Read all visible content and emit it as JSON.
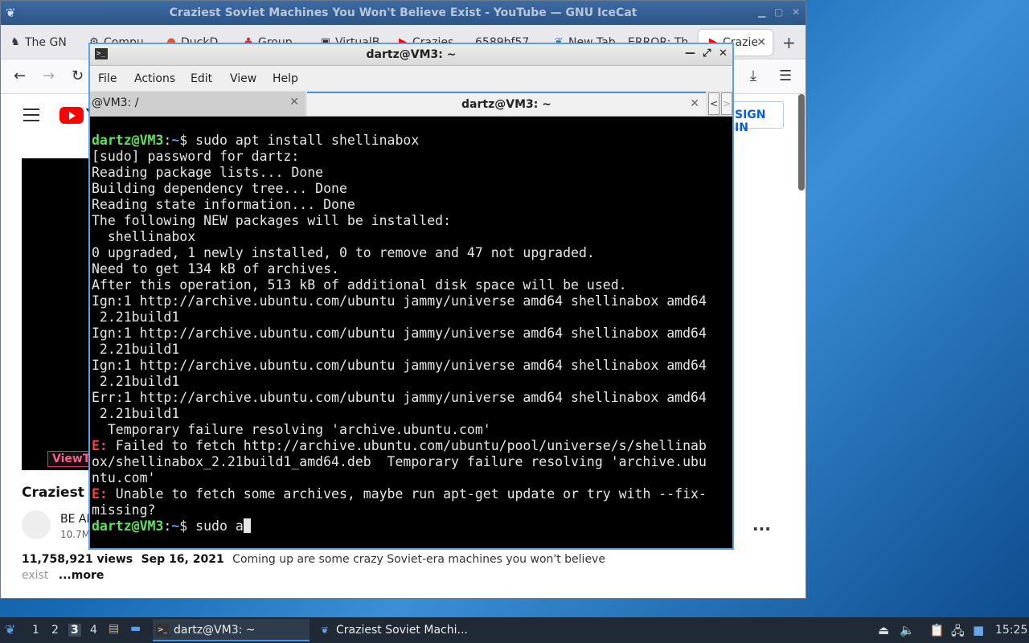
{
  "browser": {
    "window_title": "Craziest Soviet Machines You Won't Believe Exist - YouTube — GNU IceCat",
    "tabs": [
      {
        "label": "The GN",
        "favicon": "gnu-icon"
      },
      {
        "label": "Compu",
        "favicon": "puzzle-icon"
      },
      {
        "label": "DuckD",
        "favicon": "duck-icon"
      },
      {
        "label": "Group",
        "favicon": "group-icon"
      },
      {
        "label": "VirtualB",
        "favicon": "virtualbox-icon"
      },
      {
        "label": "Crazies",
        "favicon": "youtube-icon"
      },
      {
        "label": "6589bf57",
        "favicon": ""
      },
      {
        "label": "New Tab",
        "favicon": "icecat-icon"
      },
      {
        "label": "ERROR: Th",
        "favicon": ""
      },
      {
        "label": "Crazie",
        "favicon": "youtube-icon",
        "active": true
      }
    ],
    "newtab": "+",
    "youtube": {
      "logo_text": "Y",
      "sign_in": "SIGN IN",
      "video_badge": "ViewT",
      "video_title": "Craziest So",
      "channel_name": "BE AM",
      "channel_subs": "10.7M",
      "more_actions": "...",
      "views": "11,758,921 views",
      "date": "Sep 16, 2021",
      "description": "Coming up are some crazy Soviet-era machines you won't believe",
      "description_line2": "exist",
      "more_link": "...more"
    }
  },
  "terminal": {
    "window_title": "dartz@VM3: ~",
    "menu": [
      "File",
      "Actions",
      "Edit",
      "View",
      "Help"
    ],
    "tabs": [
      {
        "label": "@VM3: /",
        "active": false
      },
      {
        "label": "dartz@VM3: ~",
        "active": true
      }
    ],
    "close_glyph": "✕",
    "prompt_user": "dartz@VM3",
    "prompt_path": "~",
    "lines": {
      "l1_cmd": "$ sudo apt install shellinabox",
      "l2": "[sudo] password for dartz:",
      "l3": "Reading package lists... Done",
      "l4": "Building dependency tree... Done",
      "l5": "Reading state information... Done",
      "l6": "The following NEW packages will be installed:",
      "l7": "  shellinabox",
      "l8": "0 upgraded, 1 newly installed, 0 to remove and 47 not upgraded.",
      "l9": "Need to get 134 kB of archives.",
      "l10": "After this operation, 513 kB of additional disk space will be used.",
      "l11": "Ign:1 http://archive.ubuntu.com/ubuntu jammy/universe amd64 shellinabox amd64",
      "l12": " 2.21build1",
      "l13": "Ign:1 http://archive.ubuntu.com/ubuntu jammy/universe amd64 shellinabox amd64",
      "l14": " 2.21build1",
      "l15": "Ign:1 http://archive.ubuntu.com/ubuntu jammy/universe amd64 shellinabox amd64",
      "l16": " 2.21build1",
      "l17": "Err:1 http://archive.ubuntu.com/ubuntu jammy/universe amd64 shellinabox amd64",
      "l18": " 2.21build1",
      "l19": "  Temporary failure resolving 'archive.ubuntu.com'",
      "err_tag": "E:",
      "l20": " Failed to fetch http://archive.ubuntu.com/ubuntu/pool/universe/s/shellinab",
      "l21": "ox/shellinabox_2.21build1_amd64.deb  Temporary failure resolving 'archive.ubu",
      "l22": "ntu.com'",
      "l23": " Unable to fetch some archives, maybe run apt-get update or try with --fix-",
      "l24": "missing?",
      "l25_cmd": "$ sudo a"
    }
  },
  "taskbar": {
    "workspaces": [
      "1",
      "2",
      "3",
      "4"
    ],
    "active_workspace": "3",
    "tasks": [
      {
        "label": "dartz@VM3: ~",
        "icon": "terminal-icon"
      },
      {
        "label": "Craziest Soviet Machi...",
        "icon": "icecat-icon"
      }
    ],
    "clock": "15:25"
  }
}
